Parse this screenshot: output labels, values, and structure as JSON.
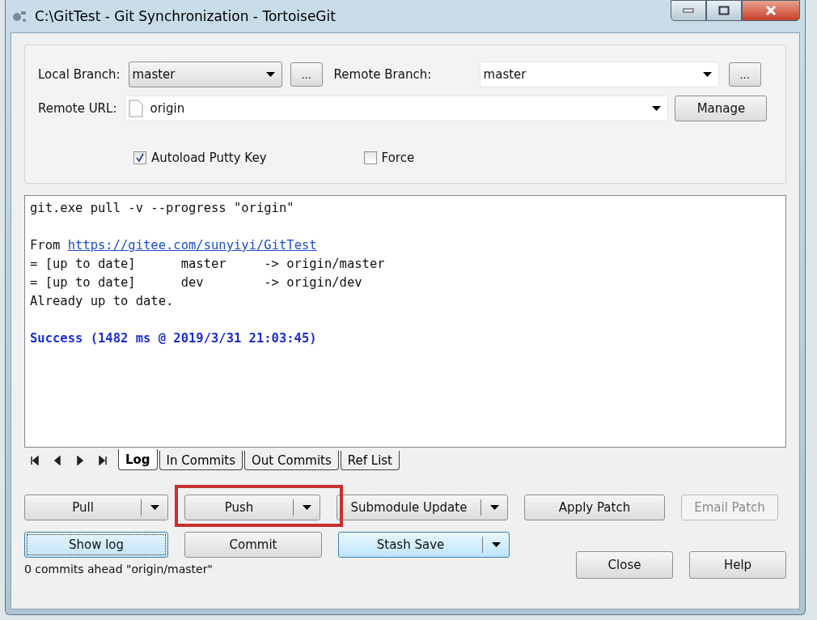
{
  "window": {
    "title": "C:\\GitTest - Git Synchronization - TortoiseGit"
  },
  "branches": {
    "local_label": "Local Branch:",
    "local_value": "master",
    "local_browse": "...",
    "remote_label": "Remote Branch:",
    "remote_value": "master",
    "remote_browse": "...",
    "url_label": "Remote URL:",
    "url_value": "origin",
    "manage": "Manage"
  },
  "options": [
    {
      "label": "Autoload Putty Key",
      "checked": true
    },
    {
      "label": "Force",
      "checked": false
    }
  ],
  "log": [
    {
      "kind": "text",
      "text": "git.exe pull -v --progress \"origin\""
    },
    {
      "kind": "blank"
    },
    {
      "kind": "link",
      "text": "From ",
      "link": "https://gitee.com/sunyiyi/GitTest"
    },
    {
      "kind": "text",
      "text": "= [up to date]      master     -> origin/master"
    },
    {
      "kind": "text",
      "text": "= [up to date]      dev        -> origin/dev"
    },
    {
      "kind": "text",
      "text": "Already up to date."
    },
    {
      "kind": "blank"
    },
    {
      "kind": "success",
      "text": "Success (1482 ms @ 2019/3/31 21:03:45)"
    }
  ],
  "tabs": [
    {
      "label": "Log",
      "selected": true
    },
    {
      "label": "In Commits",
      "selected": false
    },
    {
      "label": "Out Commits",
      "selected": false
    },
    {
      "label": "Ref List",
      "selected": false
    }
  ],
  "buttons_row1": [
    {
      "label": "Pull",
      "kind": "split",
      "disabled": false,
      "focused": false,
      "hot": false,
      "highlighted": false
    },
    {
      "label": "Push",
      "kind": "split",
      "disabled": false,
      "focused": false,
      "hot": false,
      "highlighted": true
    },
    {
      "label": "Submodule Update",
      "kind": "split",
      "disabled": false,
      "focused": false,
      "hot": false,
      "highlighted": false
    },
    {
      "label": "Apply Patch",
      "kind": "plain",
      "disabled": false,
      "focused": false,
      "hot": false,
      "highlighted": false
    },
    {
      "label": "Email Patch",
      "kind": "plain",
      "disabled": true,
      "focused": false,
      "hot": false,
      "highlighted": false
    }
  ],
  "buttons_row2": [
    {
      "label": "Show log",
      "kind": "plain",
      "disabled": false,
      "focused": true,
      "hot": false,
      "highlighted": false
    },
    {
      "label": "Commit",
      "kind": "plain",
      "disabled": false,
      "focused": false,
      "hot": false,
      "highlighted": false
    },
    {
      "label": "Stash Save",
      "kind": "split",
      "disabled": false,
      "focused": false,
      "hot": true,
      "highlighted": false
    }
  ],
  "status": "0 commits ahead \"origin/master\"",
  "dialog_buttons": [
    "Close",
    "Help"
  ]
}
